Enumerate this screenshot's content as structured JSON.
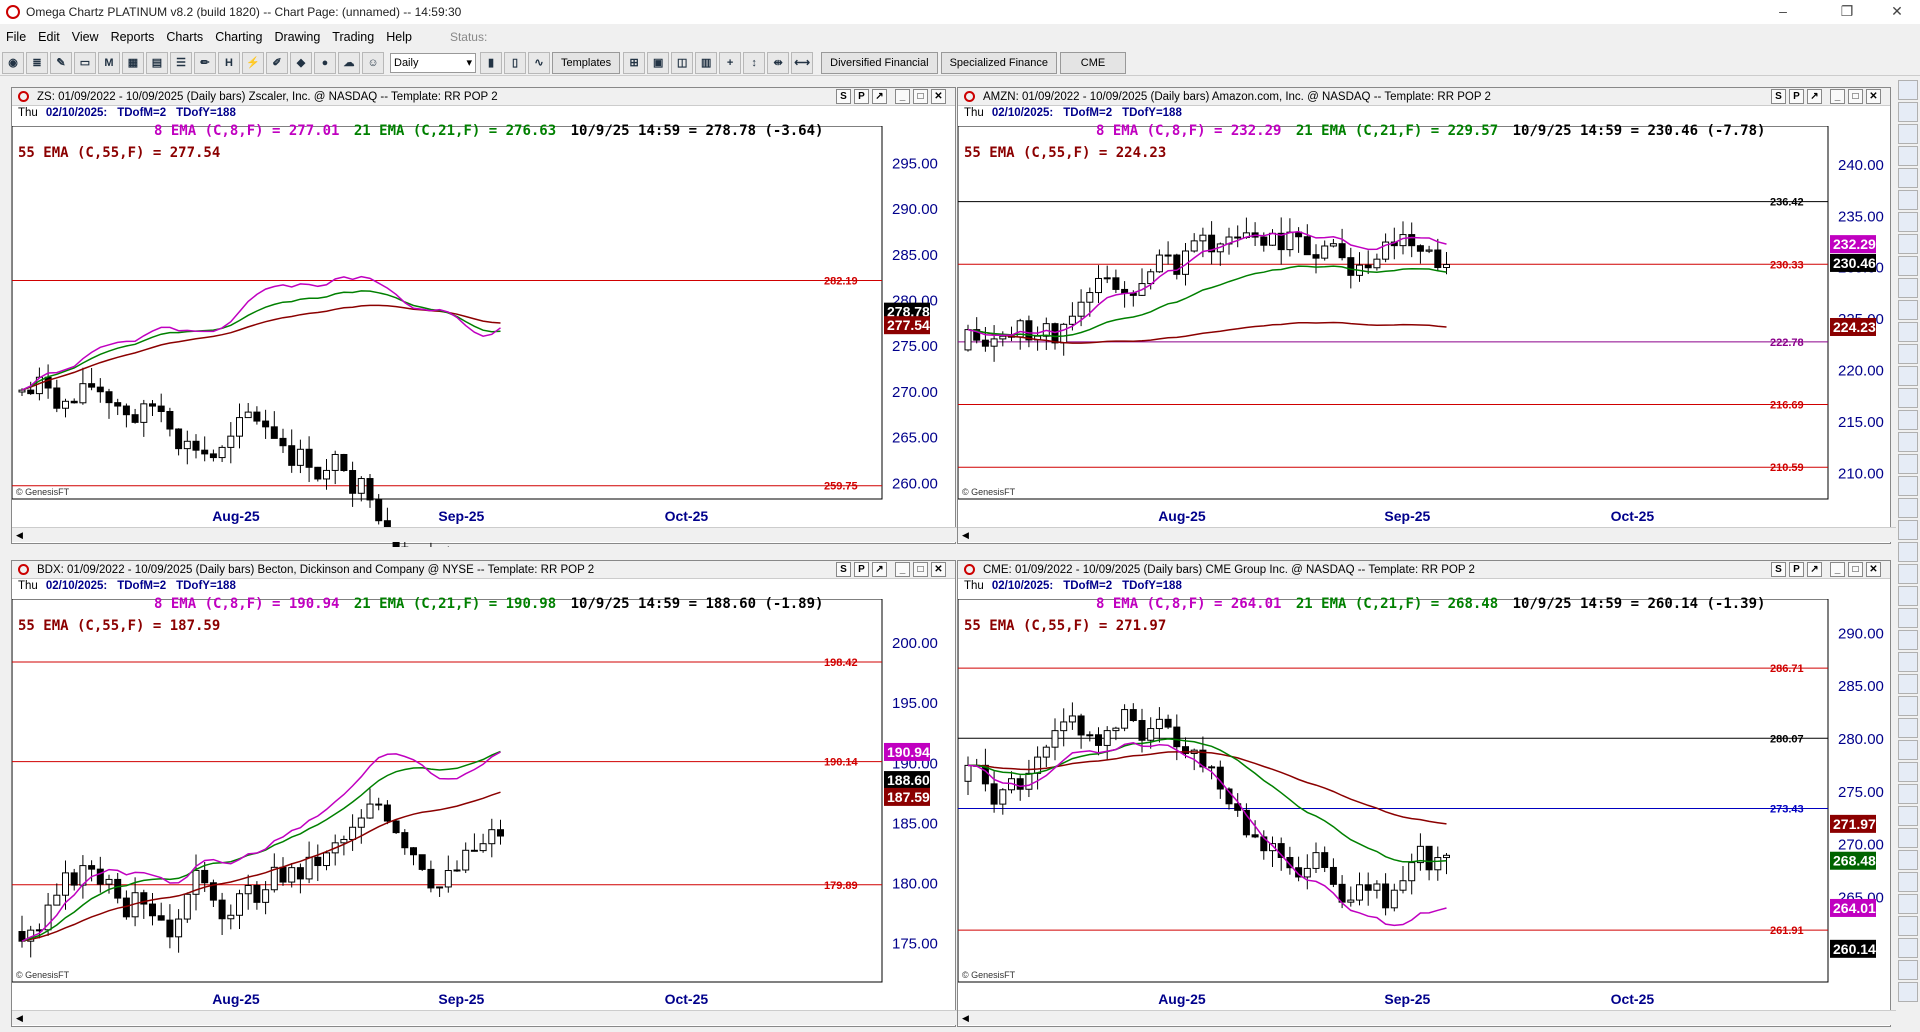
{
  "window": {
    "title": "Omega Chartz PLATINUM v8.2 (build 1820)  --  Chart Page: (unnamed) -- 14:59:30"
  },
  "menu": {
    "items": [
      "File",
      "Edit",
      "View",
      "Reports",
      "Charts",
      "Charting",
      "Drawing",
      "Trading",
      "Help"
    ],
    "status_label": "Status:"
  },
  "toolbar": {
    "period": "Daily",
    "templates": "Templates",
    "tabs": [
      "Diversified Financial",
      "Specialized Finance",
      "CME"
    ]
  },
  "panes": [
    {
      "header": "ZS: 01/09/2022 - 10/09/2025  (Daily bars)   Zscaler, Inc. @ NASDAQ  --  Template: RR POP 2",
      "date": "Thu",
      "date2": "02/10/2025:",
      "tdm": "TDofM=2",
      "tdy": "TDofY=188",
      "ema8": "8 EMA (C,8,F) = 277.01",
      "ema21": "21 EMA (C,21,F) = 276.63",
      "quote": "10/9/25 14:59 = 278.78 (-3.64)",
      "ema55": "55 EMA (C,55,F) = 277.54",
      "yticks": [
        295,
        290,
        285,
        280,
        275,
        270,
        265,
        260
      ],
      "ymin": 258.3,
      "ymax": 298.2,
      "hlines": [
        {
          "v": 282.19,
          "label": "282.19",
          "color": "#d00000"
        },
        {
          "v": 259.75,
          "label": "259.75",
          "color": "#d00000"
        }
      ],
      "badges": [
        {
          "v": 278.78,
          "text": "278.78",
          "bg": "#000000"
        },
        {
          "v": 277.3,
          "text": "277.54",
          "bg": "#8b0000"
        }
      ],
      "start": 270,
      "drift": -0.1,
      "seed": 7,
      "ema8v": 277.01,
      "ema21v": 276.63,
      "ema55v": 277.54,
      "xlabels": [
        "Aug-25",
        "Sep-25",
        "Oct-25"
      ],
      "logo": "© GenesisFT"
    },
    {
      "header": "AMZN: 01/09/2022 - 10/09/2025  (Daily bars)   Amazon.com, Inc. @ NASDAQ  --  Template: RR POP 2",
      "date": "Thu",
      "date2": "02/10/2025:",
      "tdm": "TDofM=2",
      "tdy": "TDofY=188",
      "ema8": "8 EMA (C,8,F) = 232.29",
      "ema21": "21 EMA (C,21,F) = 229.57",
      "quote": "10/9/25 14:59 = 230.46 (-7.78)",
      "ema55": "55 EMA (C,55,F) = 224.23",
      "yticks": [
        240,
        235,
        230,
        225,
        220,
        215,
        210
      ],
      "ymin": 207.5,
      "ymax": 243.0,
      "hlines": [
        {
          "v": 236.42,
          "label": "236.42",
          "color": "#000000"
        },
        {
          "v": 230.33,
          "label": "230.33",
          "color": "#d00000"
        },
        {
          "v": 222.78,
          "label": "222.78",
          "color": "#8b008b"
        },
        {
          "v": 216.69,
          "label": "216.69",
          "color": "#d00000"
        },
        {
          "v": 210.59,
          "label": "210.59",
          "color": "#d00000"
        }
      ],
      "badges": [
        {
          "v": 232.29,
          "text": "232.29",
          "bg": "#c000c0"
        },
        {
          "v": 230.46,
          "text": "230.46",
          "bg": "#000000"
        },
        {
          "v": 224.23,
          "text": "224.23",
          "bg": "#8b0000"
        }
      ],
      "start": 222,
      "drift": 0.18,
      "seed": 11,
      "ema8v": 232.29,
      "ema21v": 229.57,
      "ema55v": 224.23,
      "xlabels": [
        "Aug-25",
        "Sep-25",
        "Oct-25"
      ],
      "logo": "© GenesisFT"
    },
    {
      "header": "BDX: 01/09/2022 - 10/09/2025  (Daily bars)   Becton, Dickinson and Company @ NYSE  --  Template: RR POP 2",
      "date": "Thu",
      "date2": "02/10/2025:",
      "tdm": "TDofM=2",
      "tdy": "TDofY=188",
      "ema8": "8 EMA (C,8,F) = 190.94",
      "ema21": "21 EMA (C,21,F) = 190.98",
      "quote": "10/9/25 14:59 = 188.60 (-1.89)",
      "ema55": "55 EMA (C,55,F) = 187.59",
      "yticks": [
        200,
        195,
        190,
        185,
        180,
        175
      ],
      "ymin": 171.8,
      "ymax": 203.0,
      "hlines": [
        {
          "v": 198.42,
          "label": "198.42",
          "color": "#d00000"
        },
        {
          "v": 190.14,
          "label": "190.14",
          "color": "#d00000"
        },
        {
          "v": 179.89,
          "label": "179.89",
          "color": "#d00000"
        }
      ],
      "badges": [
        {
          "v": 190.94,
          "text": "190.94",
          "bg": "#c000c0"
        },
        {
          "v": 188.6,
          "text": "188.60",
          "bg": "#000000"
        },
        {
          "v": 187.2,
          "text": "187.59",
          "bg": "#8b0000"
        }
      ],
      "start": 176,
      "drift": 0.3,
      "seed": 3,
      "ema8v": 190.94,
      "ema21v": 190.98,
      "ema55v": 187.59,
      "xlabels": [
        "Aug-25",
        "Sep-25",
        "Oct-25"
      ],
      "logo": "© GenesisFT"
    },
    {
      "header": "CME: 01/09/2022 - 10/09/2025  (Daily bars)   CME Group Inc. @ NASDAQ  --  Template: RR POP 2",
      "date": "Thu",
      "date2": "02/10/2025:",
      "tdm": "TDofM=2",
      "tdy": "TDofY=188",
      "ema8": "8 EMA (C,8,F) = 264.01",
      "ema21": "21 EMA (C,21,F) = 268.48",
      "quote": "10/9/25 14:59 = 260.14 (-1.39)",
      "ema55": "55 EMA (C,55,F) = 271.97",
      "yticks": [
        290,
        285,
        280,
        275,
        270,
        265
      ],
      "ymin": 257.0,
      "ymax": 292.5,
      "hlines": [
        {
          "v": 286.71,
          "label": "286.71",
          "color": "#d00000"
        },
        {
          "v": 280.07,
          "label": "280.07",
          "color": "#000000"
        },
        {
          "v": 273.43,
          "label": "273.43",
          "color": "#0000c0"
        },
        {
          "v": 261.91,
          "label": "261.91",
          "color": "#d00000"
        }
      ],
      "badges": [
        {
          "v": 271.97,
          "text": "271.97",
          "bg": "#8b0000"
        },
        {
          "v": 268.48,
          "text": "268.48",
          "bg": "#006400"
        },
        {
          "v": 264.01,
          "text": "264.01",
          "bg": "#c000c0"
        },
        {
          "v": 260.14,
          "text": "260.14",
          "bg": "#000000"
        }
      ],
      "start": 276,
      "drift": -0.22,
      "seed": 5,
      "ema8v": 264.01,
      "ema21v": 268.48,
      "ema55v": 271.97,
      "xlabels": [
        "Aug-25",
        "Sep-25",
        "Oct-25"
      ],
      "logo": "© GenesisFT"
    }
  ],
  "colors": {
    "ema8": "#c000c0",
    "ema21": "#008000",
    "ema55": "#8b0000",
    "axis": "#00008b"
  }
}
